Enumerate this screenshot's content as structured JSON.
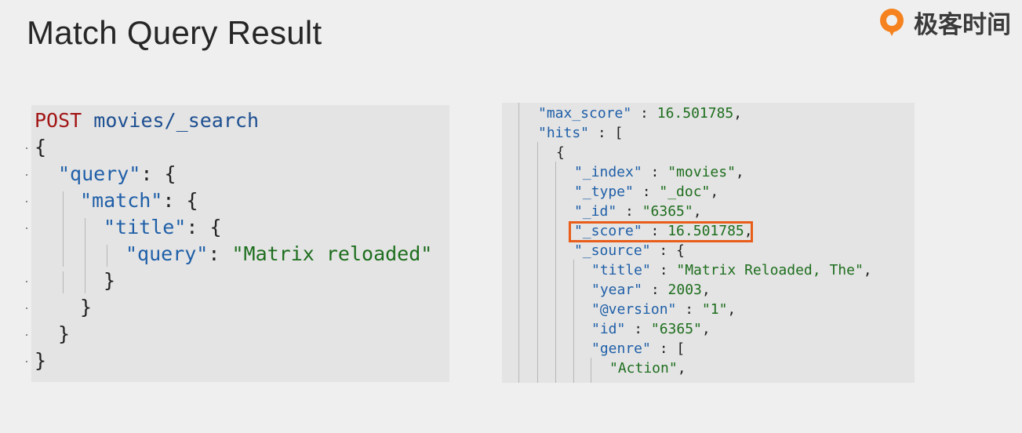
{
  "slide": {
    "title": "Match Query Result",
    "brand": "极客时间",
    "accent_color": "#f5821f",
    "highlight_color": "#e85d1a"
  },
  "request": {
    "method": "POST",
    "path": "movies/_search",
    "open_brace": "{",
    "query_key": "\"query\"",
    "match_key": "\"match\"",
    "title_key": "\"title\"",
    "inner_query_key": "\"query\"",
    "query_value": "\"Matrix reloaded\"",
    "colon_brace": ": {",
    "colon": ": ",
    "close_brace": "}"
  },
  "response": {
    "lines": [
      {
        "key": "\"max_score\"",
        "sep": " : ",
        "value": "16.501785",
        "tail": ","
      },
      {
        "key": "\"hits\"",
        "sep": " : ",
        "value": "",
        "tail": "["
      },
      {
        "key": "",
        "sep": "",
        "value": "",
        "tail": "{"
      },
      {
        "key": "\"_index\"",
        "sep": " : ",
        "value": "\"movies\"",
        "tail": ","
      },
      {
        "key": "\"_type\"",
        "sep": " : ",
        "value": "\"_doc\"",
        "tail": ","
      },
      {
        "key": "\"_id\"",
        "sep": " : ",
        "value": "\"6365\"",
        "tail": ","
      },
      {
        "key": "\"_score\"",
        "sep": " : ",
        "value": "16.501785",
        "tail": ","
      },
      {
        "key": "\"_source\"",
        "sep": " : ",
        "value": "",
        "tail": "{"
      },
      {
        "key": "\"title\"",
        "sep": " : ",
        "value": "\"Matrix Reloaded, The\"",
        "tail": ","
      },
      {
        "key": "\"year\"",
        "sep": " : ",
        "value": "2003",
        "tail": ","
      },
      {
        "key": "\"@version\"",
        "sep": " : ",
        "value": "\"1\"",
        "tail": ","
      },
      {
        "key": "\"id\"",
        "sep": " : ",
        "value": "\"6365\"",
        "tail": ","
      },
      {
        "key": "\"genre\"",
        "sep": " : ",
        "value": "",
        "tail": "["
      },
      {
        "key": "",
        "sep": "",
        "value": "\"Action\"",
        "tail": ","
      }
    ]
  }
}
